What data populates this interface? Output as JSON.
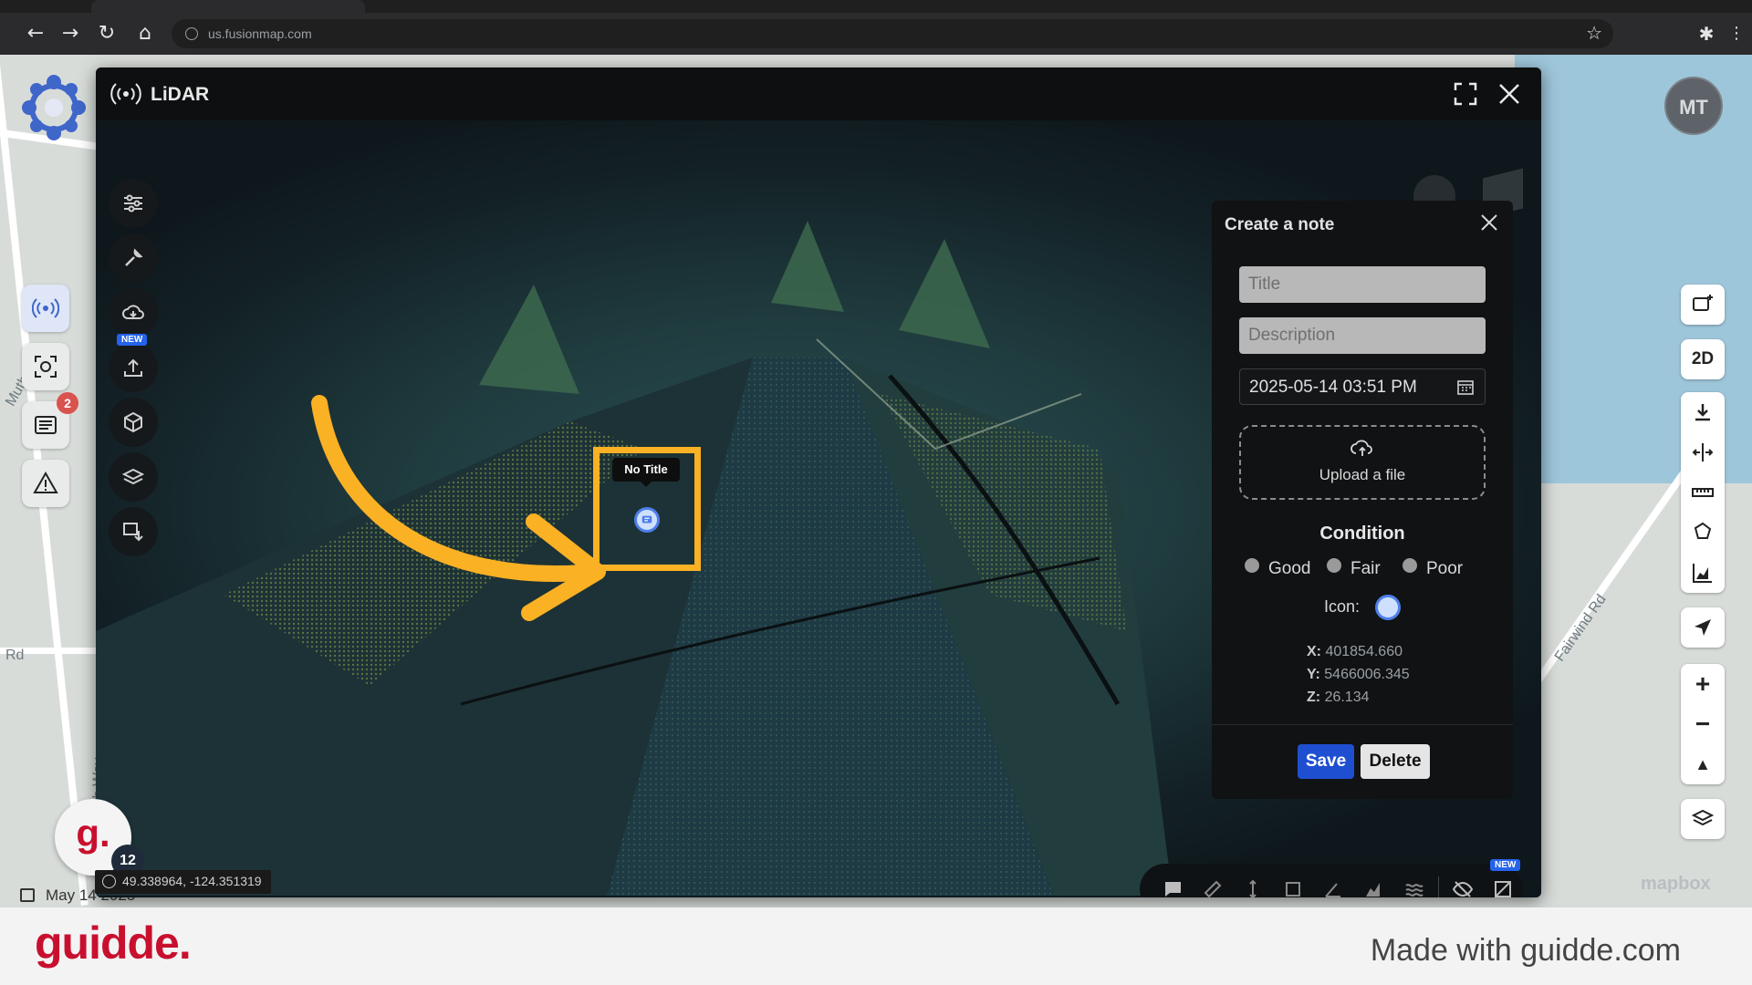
{
  "browser": {
    "url": "us.fusionmap.com"
  },
  "map": {
    "labels": [
      "Muth",
      "Rd",
      "Fairwind Rd",
      "Smith Way"
    ],
    "avatar_initials": "MT",
    "notes_badge": "2",
    "view_toggle_label": "2D",
    "attribution": "mapbox",
    "date_text": "May 14 2025",
    "coordinates": "49.338964, -124.351319",
    "guidde_count": "12",
    "guidde_letter": "g."
  },
  "lidar": {
    "title": "LiDAR",
    "new_badge": "NEW",
    "marker_title": "No Title"
  },
  "note_panel": {
    "heading": "Create a note",
    "title_placeholder": "Title",
    "description_placeholder": "Description",
    "datetime": "2025-05-14 03:51 PM",
    "upload_label": "Upload a file",
    "condition_heading": "Condition",
    "conditions": [
      "Good",
      "Fair",
      "Poor"
    ],
    "icon_label": "Icon:",
    "x_label": "X:",
    "x_value": "401854.660",
    "y_label": "Y:",
    "y_value": "5466006.345",
    "z_label": "Z:",
    "z_value": "26.134",
    "save_label": "Save",
    "delete_label": "Delete"
  },
  "footer": {
    "brand": "guidde.",
    "tagline": "Made with guidde.com"
  },
  "colors": {
    "highlight": "#fbb124",
    "save": "#1f4fd1",
    "brand": "#c8102e",
    "point_cloud_a": "#2c5155",
    "point_cloud_b": "#7e9a3a"
  }
}
